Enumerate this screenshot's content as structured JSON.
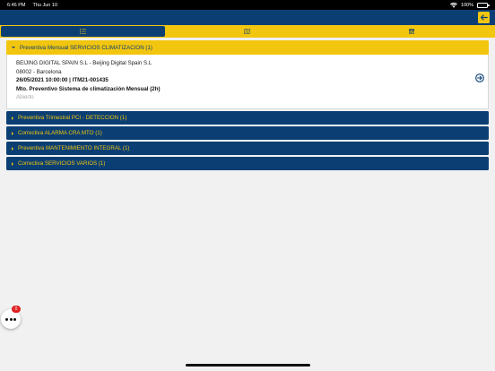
{
  "status_bar": {
    "time": "6:46 PM",
    "date": "Thu Jun 10",
    "battery": "100%"
  },
  "header": {
    "back_icon": "arrow-left-icon",
    "accent": "#f2c60f",
    "primary": "#0b3f74"
  },
  "tabs": [
    {
      "icon": "list-icon",
      "active": true
    },
    {
      "icon": "map-icon",
      "active": false
    },
    {
      "icon": "calendar-icon",
      "active": false
    }
  ],
  "groups": [
    {
      "title": "Preventiva Mensual SERVICIOS CLIMATIZACION (1)",
      "expanded": true,
      "items": [
        {
          "client": "BEIJING DIGITAL SPAIN S.L - Beijing Digital Spain S.L",
          "location": "08002 - Barcelona",
          "datetime_code": "26/05/2021 10:00:00 | ITM21-001435",
          "description": "Mto. Preventivo Sistema de climatización Mensual (2h)",
          "status": "Abierto"
        }
      ]
    },
    {
      "title": "Preventiva Trimestral PCI - DETECCION (1)",
      "expanded": false
    },
    {
      "title": "Correctiva ALARMA CRA MTO (1)",
      "expanded": false
    },
    {
      "title": "Preventiva MANTENIMIENTO INTEGRAL (1)",
      "expanded": false
    },
    {
      "title": "Correctiva SERVICIOS VARIOS (1)",
      "expanded": false
    }
  ],
  "fab": {
    "badge": "0",
    "icon": "more-dots-icon"
  }
}
